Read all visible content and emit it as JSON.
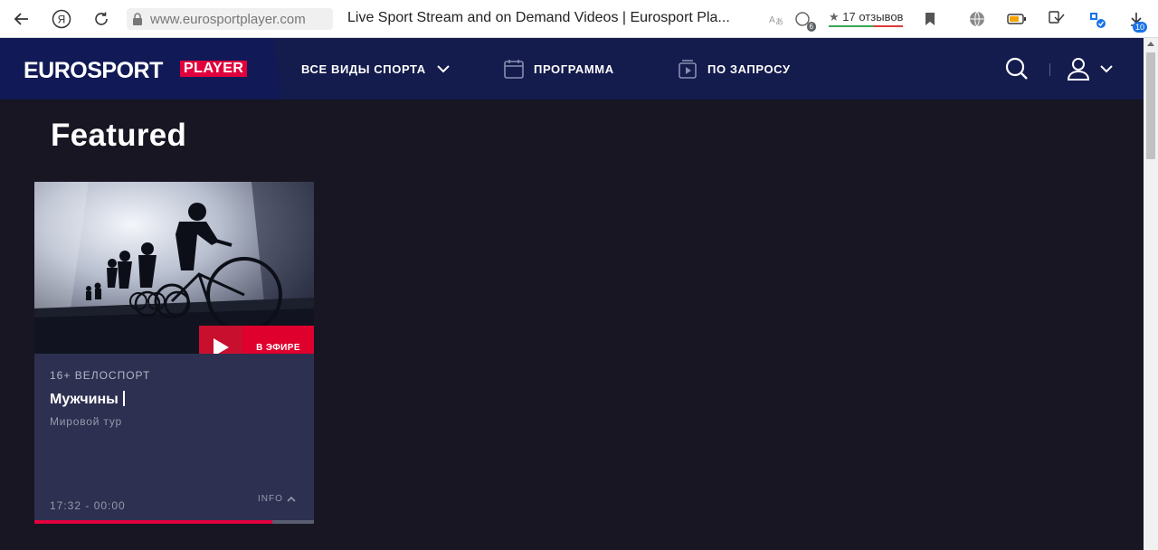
{
  "browser": {
    "url": "www.eurosportplayer.com",
    "page_title": "Live Sport Stream and on Demand Videos | Eurosport Pla...",
    "reviews": "17 отзывов",
    "tabs_badge": "6",
    "downloads_badge": "10",
    "yandex_glyph": "Я"
  },
  "header": {
    "logo_main": "EUROSPORT",
    "logo_sub": "PLAYER",
    "nav": [
      {
        "label": "ВСЕ ВИДЫ СПОРТА"
      },
      {
        "label": "ПРОГРАММА"
      },
      {
        "label": "ПО ЗАПРОСУ"
      }
    ]
  },
  "section": {
    "title": "Featured"
  },
  "card": {
    "live_label": "В ЭФИРЕ",
    "category": "16+ ВЕЛОСПОРТ",
    "title": "Мужчины",
    "subtitle": "Мировой тур",
    "time": "17:32 - 00:00",
    "info_label": "INFO",
    "progress": 0.85
  },
  "colors": {
    "accent": "#e0003c",
    "header_bg": "#141b4d",
    "page_bg": "#171622",
    "card_bg": "#2d3050"
  }
}
